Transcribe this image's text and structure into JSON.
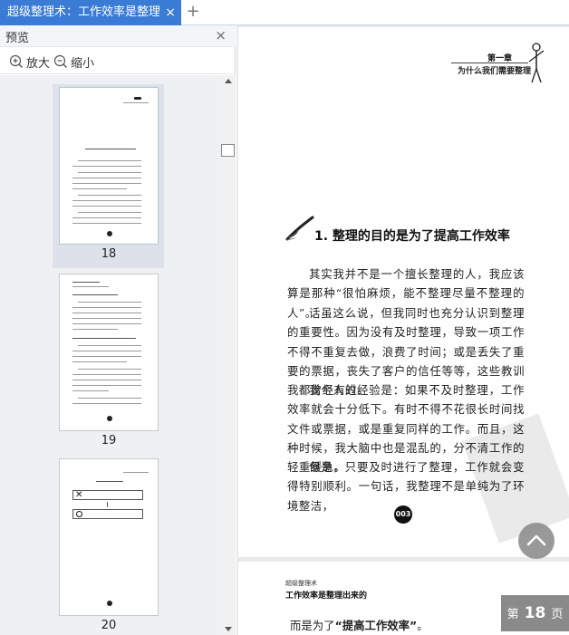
{
  "tab": {
    "title": "超级整理术：工作效率是整理出来的",
    "close": "×",
    "new_tab": "+"
  },
  "sidebar": {
    "title": "预览",
    "close": "×",
    "zoom_in_label": "放大",
    "zoom_out_label": "缩小",
    "thumbnails": [
      {
        "label": "18",
        "selected": true
      },
      {
        "label": "19",
        "selected": false
      },
      {
        "label": "20",
        "selected": false
      }
    ]
  },
  "page": {
    "chapter_badge": "第一章",
    "chapter_subtitle": "为什么我们需要整理",
    "section_title": "1. 整理的目的是为了提高工作效率",
    "paragraphs": [
      "其实我并不是一个擅长整理的人，我应该算是那种“很怕麻烦，能不整理尽量不整理的人”。",
      "话虽这么说，但我同时也充分认识到整理的重要性。因为没有及时整理，导致一项工作不得不重复去做，浪费了时间；或是丢失了重要的票据，丧失了客户的信任等等，这些教训我都曾经有过。",
      "我个人的经验是：如果不及时整理，工作效率就会十分低下。有时不得不花很长时间找文件或票据，或是重复同样的工作。而且，这种时候，我大脑中也是混乱的，分不清工作的轻重缓急。",
      "但是，只要及时进行了整理，工作就会变得特别顺利。一句话，我整理不是单纯为了环境整洁，"
    ],
    "page_number": "003"
  },
  "next_page": {
    "header_small": "超级整理术",
    "header": "工作效率是整理出来的",
    "text_before": "而是为了",
    "text_bold": "“提高工作效率”",
    "text_after": "。"
  },
  "page_indicator": {
    "prefix": "第",
    "number": "18",
    "suffix": "页"
  },
  "colors": {
    "tab_active": "#3a7bd5",
    "indicator_bg": "#8a8a8a"
  }
}
